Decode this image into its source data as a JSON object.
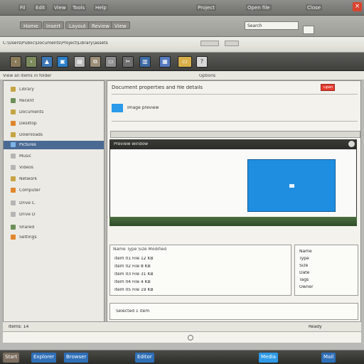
{
  "window": {
    "menu": [
      "Fil",
      "Edit",
      "View",
      "Tools",
      "Help"
    ],
    "title_right": [
      "Project",
      "Open file",
      "Close"
    ]
  },
  "toolbar2": {
    "tabs": [
      "Home",
      "Insert",
      "Layout",
      "Review",
      "View"
    ],
    "search_placeholder": "Search"
  },
  "address": {
    "path": "C:\\Users\\Public\\Documents\\Project\\Library\\assets"
  },
  "ribbon": {
    "label": "View all items in folder",
    "right": "Options"
  },
  "sidebar": {
    "items": [
      {
        "label": "Library",
        "selected": false
      },
      {
        "label": "Recent",
        "selected": false
      },
      {
        "label": "Documents",
        "selected": false
      },
      {
        "label": "Desktop",
        "selected": false
      },
      {
        "label": "Downloads",
        "selected": false
      },
      {
        "label": "Pictures",
        "selected": true
      },
      {
        "label": "Music",
        "selected": false
      },
      {
        "label": "Videos",
        "selected": false
      },
      {
        "label": "Network",
        "selected": false
      },
      {
        "label": "Computer",
        "selected": false
      },
      {
        "label": "Drive C",
        "selected": false
      },
      {
        "label": "Drive D",
        "selected": false
      },
      {
        "label": "Shared",
        "selected": false
      },
      {
        "label": "Settings",
        "selected": false
      }
    ]
  },
  "main": {
    "header_title": "Document properties and file details",
    "header_button": "Open",
    "sub_label": "Image preview",
    "preview_label": "Preview window",
    "list_header": "Name   Type   Size   Modified",
    "rows": [
      "item 01   File   12 KB",
      "item 02   File   8 KB",
      "item 03   File   31 KB",
      "item 04   File   4 KB",
      "item 05   File   19 KB"
    ],
    "side_rows": [
      "Name",
      "Type",
      "Size",
      "Date",
      "Tags",
      "Owner"
    ]
  },
  "status": {
    "left": "Items: 14",
    "center": "Selected 1 item",
    "right": "Ready"
  },
  "taskbar": {
    "start": "Start",
    "items": [
      "Explorer",
      "Browser",
      "Editor",
      "Media",
      "Mail"
    ]
  },
  "colors": {
    "accent_blue": "#1f8ee0",
    "selection": "#4a6a94",
    "alert_red": "#e53b2d",
    "green_bar": "#4b6e3f"
  }
}
